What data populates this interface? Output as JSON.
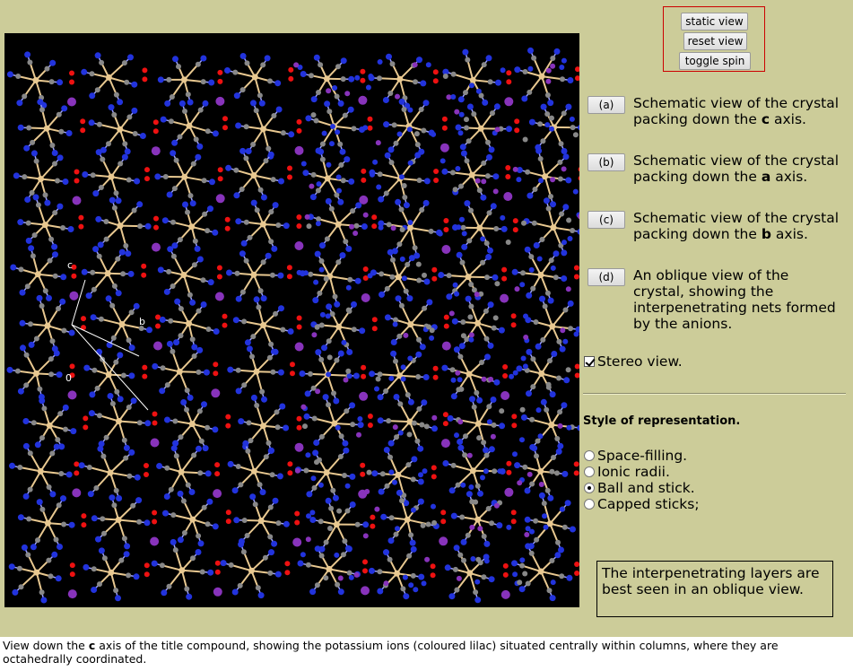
{
  "controls": {
    "static_view": "static view",
    "reset_view": "reset view",
    "toggle_spin": "toggle spin"
  },
  "views": [
    {
      "button": "(a)",
      "text_before": "Schematic view of the crystal packing down the ",
      "axis": "c",
      "text_after": " axis."
    },
    {
      "button": "(b)",
      "text_before": "Schematic view of the crystal packing down the ",
      "axis": "a",
      "text_after": " axis."
    },
    {
      "button": "(c)",
      "text_before": "Schematic view of the crystal packing down the ",
      "axis": "b",
      "text_after": " axis."
    },
    {
      "button": "(d)",
      "text_before": "An oblique view of the crystal, showing the interpenetrating nets formed by the anions.",
      "axis": "",
      "text_after": ""
    }
  ],
  "stereo": {
    "label": "Stereo view.",
    "checked": true
  },
  "style": {
    "title": "Style of representation.",
    "options": [
      "Space-filling.",
      "Ionic radii.",
      "Ball and stick.",
      "Capped sticks;"
    ],
    "selected": 2
  },
  "note": "The interpenetrating layers are best seen in an oblique view.",
  "caption": {
    "before": "View down the ",
    "axis": "c",
    "after": " axis of the title compound, showing the potassium ions (coloured lilac) situated centrally within columns, where they are octahedrally coordinated."
  },
  "viewer": {
    "axis_labels": [
      "c",
      "b",
      "0"
    ],
    "colors": {
      "background": "#000000",
      "nitrogen": "#2233dd",
      "carbon": "#888888",
      "oxygen": "#ee1111",
      "metal": "#e8c890",
      "potassium": "#8833bb"
    }
  }
}
